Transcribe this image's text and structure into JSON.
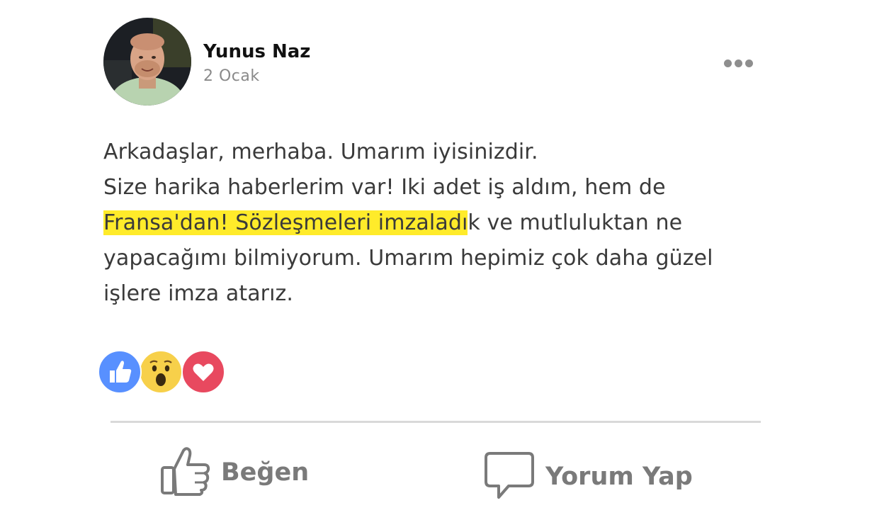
{
  "post": {
    "author": {
      "name": "Yunus Naz",
      "date": "2 Ocak"
    },
    "text": {
      "line1": "Arkadaşlar, merhaba. Umarım iyisinizdir.",
      "line2": "Size harika haberlerim var! Iki adet iş aldım, hem de",
      "line3_highlight": "Fransa'dan! Sözleşmeleri imzaladı",
      "line3_rest": "k ve mutluluktan ne",
      "line4": "yapacağımı bilmiyorum. Umarım hepimiz çok daha güzel",
      "line5": "işlere imza atarız."
    },
    "highlight_color": "#ffeb2a",
    "reactions": [
      {
        "icon": "like-reaction-icon",
        "color": "#5890ff"
      },
      {
        "icon": "wow-reaction-icon",
        "color": "#f7d04a"
      },
      {
        "icon": "love-reaction-icon",
        "color": "#e8495f"
      }
    ],
    "actions": {
      "like_label": "Beğen",
      "comment_label": "Yorum Yap"
    },
    "more_icon": "more-options-icon"
  }
}
